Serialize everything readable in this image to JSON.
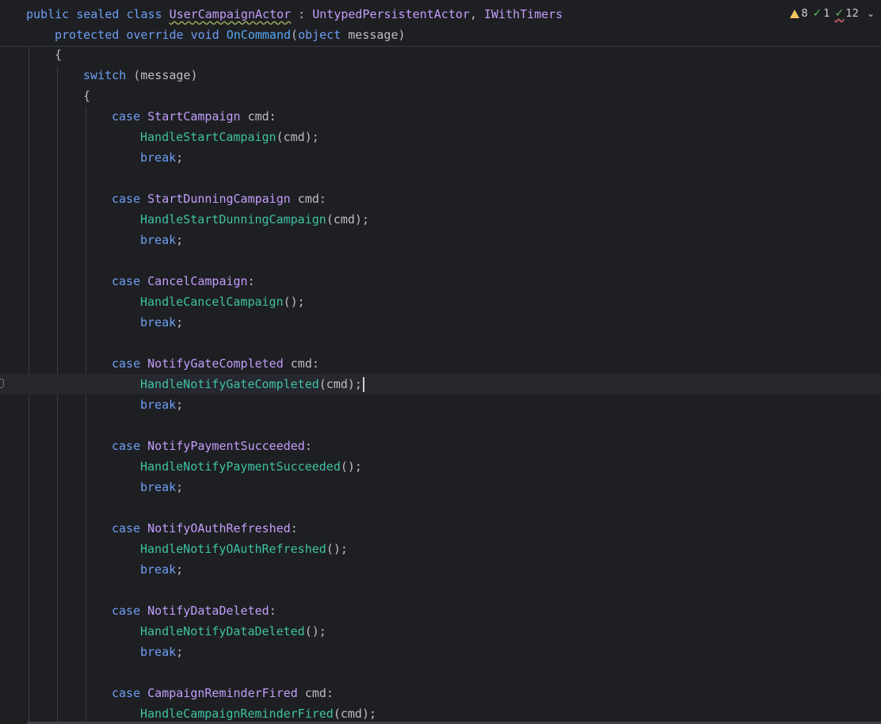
{
  "inspections": {
    "warnings": "8",
    "weak_warnings": "1",
    "typos": "12"
  },
  "sticky": {
    "class_line": {
      "public": "public",
      "sealed": "sealed",
      "class": "class",
      "class_name": "UserCampaignActor",
      "colon": " : ",
      "base": "UntypedPersistentActor",
      "comma": ", ",
      "iface": "IWithTimers"
    },
    "method_line": {
      "protected": "protected",
      "override": "override",
      "void": "void",
      "name": "OnCommand",
      "open": "(",
      "object": "object",
      "param": " message)"
    }
  },
  "code": {
    "open_brace": "{",
    "switch_kw": "switch",
    "switch_expr": " (message)",
    "switch_open": "{",
    "case_kw": "case",
    "break_kw": "break",
    "semicolon": ";",
    "cases": [
      {
        "type": "StartCampaign",
        "suffix": " cmd:",
        "call": "HandleStartCampaign",
        "args": "(cmd);"
      },
      {
        "type": "StartDunningCampaign",
        "suffix": " cmd:",
        "call": "HandleStartDunningCampaign",
        "args": "(cmd);"
      },
      {
        "type": "CancelCampaign",
        "suffix": ":",
        "call": "HandleCancelCampaign",
        "args": "();"
      },
      {
        "type": "NotifyGateCompleted",
        "suffix": " cmd:",
        "call": "HandleNotifyGateCompleted",
        "args": "(cmd);"
      },
      {
        "type": "NotifyPaymentSucceeded",
        "suffix": ":",
        "call": "HandleNotifyPaymentSucceeded",
        "args": "();"
      },
      {
        "type": "NotifyOAuthRefreshed",
        "suffix": ":",
        "call": "HandleNotifyOAuthRefreshed",
        "args": "();"
      },
      {
        "type": "NotifyDataDeleted",
        "suffix": ":",
        "call": "HandleNotifyDataDeleted",
        "args": "();"
      },
      {
        "type": "CampaignReminderFired",
        "suffix": " cmd:",
        "call": "HandleCampaignReminderFired",
        "args": "(cmd);"
      }
    ]
  }
}
